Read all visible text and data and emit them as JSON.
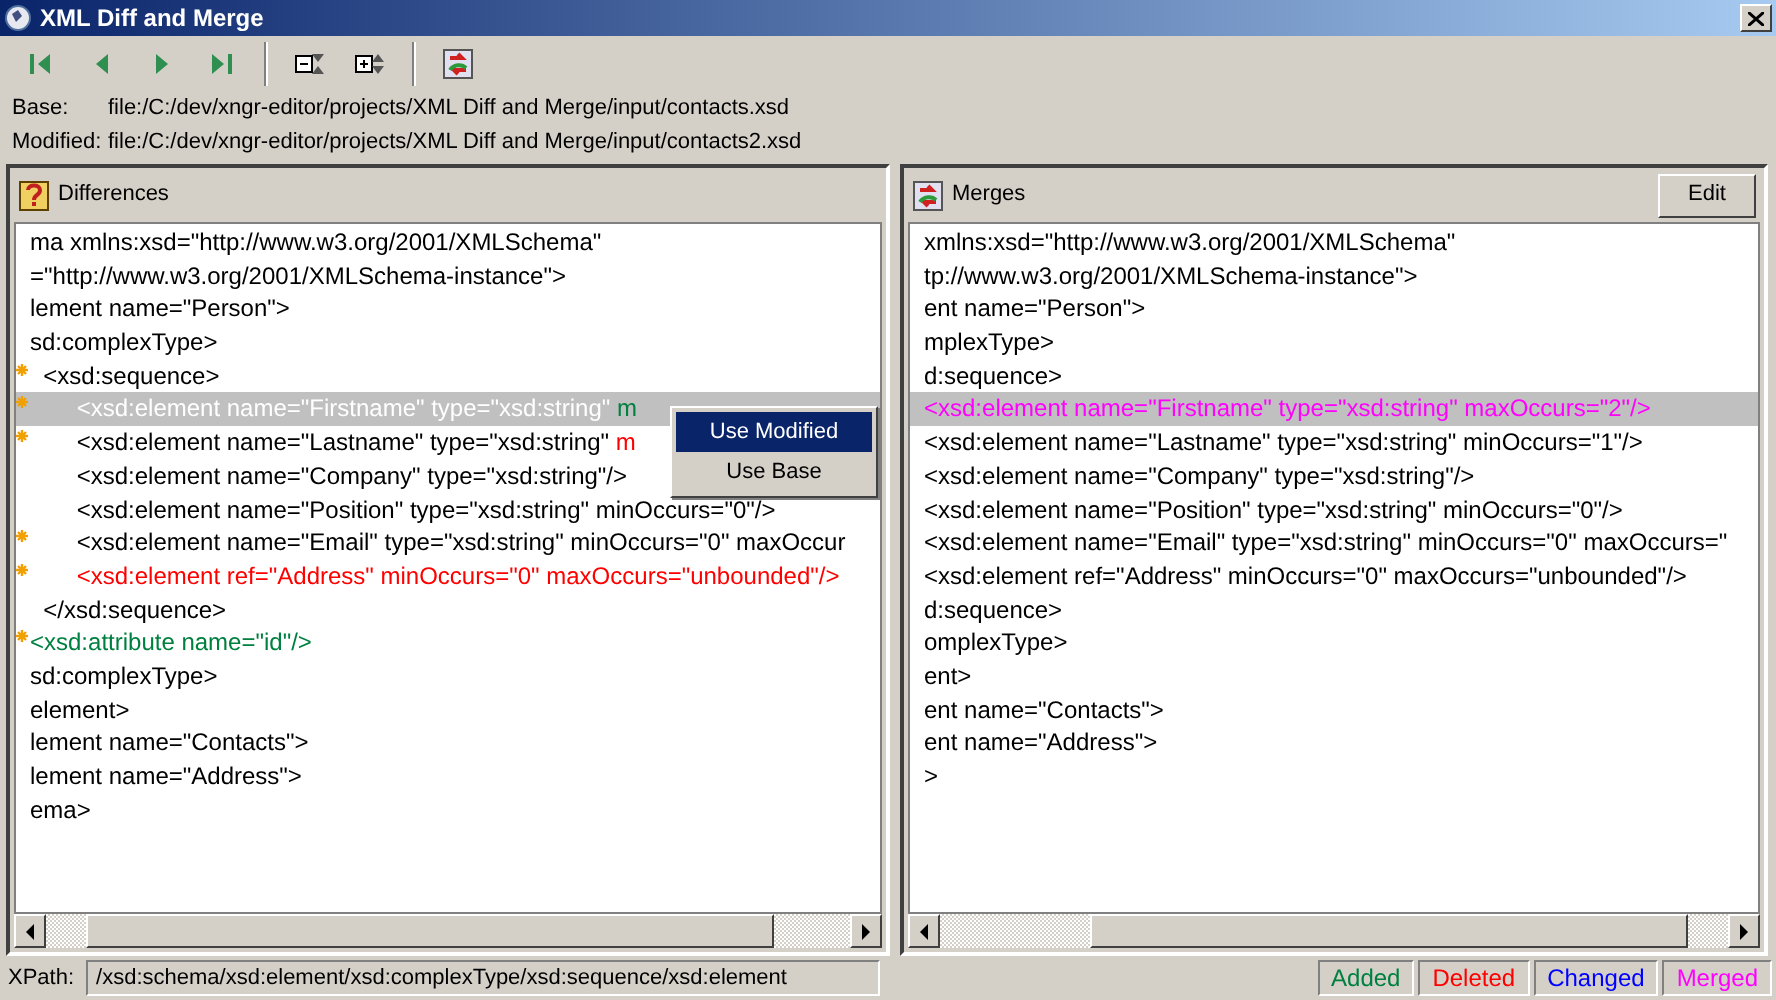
{
  "window": {
    "title": "XML Diff and Merge"
  },
  "toolbar": [
    {
      "kind": "first"
    },
    {
      "kind": "prev"
    },
    {
      "kind": "next"
    },
    {
      "kind": "last"
    },
    {
      "kind": "sep"
    },
    {
      "kind": "collapse"
    },
    {
      "kind": "expand"
    },
    {
      "kind": "sep"
    },
    {
      "kind": "merge"
    }
  ],
  "files": [
    {
      "label": "Base:",
      "path": "file:/C:/dev/xngr-editor/projects/XML Diff and Merge/input/contacts.xsd"
    },
    {
      "label": "Modified:",
      "path": "file:/C:/dev/xngr-editor/projects/XML Diff and Merge/input/contacts2.xsd"
    }
  ],
  "differences": {
    "title": "Differences",
    "lines": [
      {
        "changed": false,
        "selected": false,
        "segments": [
          {
            "kind": "normal",
            "text": "ma xmlns:xsd=\"http://www.w3.org/2001/XMLSchema\""
          }
        ]
      },
      {
        "changed": false,
        "selected": false,
        "segments": [
          {
            "kind": "normal",
            "text": "=\"http://www.w3.org/2001/XMLSchema-instance\">"
          }
        ]
      },
      {
        "changed": false,
        "selected": false,
        "segments": [
          {
            "kind": "normal",
            "text": "lement name=\"Person\">"
          }
        ]
      },
      {
        "changed": false,
        "selected": false,
        "segments": [
          {
            "kind": "normal",
            "text": "sd:complexType>"
          }
        ]
      },
      {
        "changed": true,
        "selected": false,
        "segments": [
          {
            "kind": "normal",
            "text": "  <xsd:sequence>"
          }
        ]
      },
      {
        "changed": true,
        "selected": true,
        "segments": [
          {
            "kind": "normal",
            "text": "       <xsd:element name=\"Firstname\" type=\"xsd:string\" "
          },
          {
            "kind": "added",
            "text": "m"
          }
        ]
      },
      {
        "changed": true,
        "selected": false,
        "segments": [
          {
            "kind": "normal",
            "text": "       <xsd:element name=\"Lastname\" type=\"xsd:string\" "
          },
          {
            "kind": "deleted",
            "text": "m"
          }
        ]
      },
      {
        "changed": false,
        "selected": false,
        "segments": [
          {
            "kind": "normal",
            "text": "       <xsd:element name=\"Company\" type=\"xsd:string\"/>"
          }
        ]
      },
      {
        "changed": false,
        "selected": false,
        "segments": [
          {
            "kind": "normal",
            "text": "       <xsd:element name=\"Position\" type=\"xsd:string\" minOccurs=\"0\"/>"
          }
        ]
      },
      {
        "changed": true,
        "selected": false,
        "segments": [
          {
            "kind": "normal",
            "text": "       <xsd:element name=\"Email\" type=\"xsd:string\" minOccurs=\"0\" maxOccur"
          }
        ]
      },
      {
        "changed": true,
        "selected": false,
        "segments": [
          {
            "kind": "deleted",
            "text": "       <xsd:element ref=\"Address\" minOccurs=\"0\" maxOccurs=\"unbounded\"/>"
          }
        ]
      },
      {
        "changed": false,
        "selected": false,
        "segments": [
          {
            "kind": "normal",
            "text": "  </xsd:sequence>"
          }
        ]
      },
      {
        "changed": true,
        "selected": false,
        "segments": [
          {
            "kind": "added",
            "text": "<xsd:attribute name=\"id\"/>"
          }
        ]
      },
      {
        "changed": false,
        "selected": false,
        "segments": [
          {
            "kind": "normal",
            "text": "sd:complexType>"
          }
        ]
      },
      {
        "changed": false,
        "selected": false,
        "segments": [
          {
            "kind": "normal",
            "text": "element>"
          }
        ]
      },
      {
        "changed": false,
        "selected": false,
        "segments": [
          {
            "kind": "normal",
            "text": "lement name=\"Contacts\">"
          }
        ]
      },
      {
        "changed": false,
        "selected": false,
        "segments": [
          {
            "kind": "normal",
            "text": "lement name=\"Address\">"
          }
        ]
      },
      {
        "changed": false,
        "selected": false,
        "segments": [
          {
            "kind": "normal",
            "text": "ema>"
          }
        ]
      }
    ]
  },
  "context_menu": [
    {
      "label": "Use Modified",
      "selected": true
    },
    {
      "label": "Use Base",
      "selected": false
    }
  ],
  "merges": {
    "title": "Merges",
    "button": "Edit",
    "lines": [
      {
        "selected": false,
        "segments": [
          {
            "kind": "normal",
            "text": "xmlns:xsd=\"http://www.w3.org/2001/XMLSchema\""
          }
        ]
      },
      {
        "selected": false,
        "segments": [
          {
            "kind": "normal",
            "text": "tp://www.w3.org/2001/XMLSchema-instance\">"
          }
        ]
      },
      {
        "selected": false,
        "segments": [
          {
            "kind": "normal",
            "text": "ent name=\"Person\">"
          }
        ]
      },
      {
        "selected": false,
        "segments": [
          {
            "kind": "normal",
            "text": "mplexType>"
          }
        ]
      },
      {
        "selected": false,
        "segments": [
          {
            "kind": "normal",
            "text": "d:sequence>"
          }
        ]
      },
      {
        "selected": true,
        "segments": [
          {
            "kind": "merged",
            "text": "<xsd:element name=\"Firstname\" type=\"xsd:string\" maxOccurs=\"2\"/>"
          }
        ]
      },
      {
        "selected": false,
        "segments": [
          {
            "kind": "normal",
            "text": "<xsd:element name=\"Lastname\" type=\"xsd:string\" minOccurs=\"1\"/>"
          }
        ]
      },
      {
        "selected": false,
        "segments": [
          {
            "kind": "normal",
            "text": "<xsd:element name=\"Company\" type=\"xsd:string\"/>"
          }
        ]
      },
      {
        "selected": false,
        "segments": [
          {
            "kind": "normal",
            "text": "<xsd:element name=\"Position\" type=\"xsd:string\" minOccurs=\"0\"/>"
          }
        ]
      },
      {
        "selected": false,
        "segments": [
          {
            "kind": "normal",
            "text": "<xsd:element name=\"Email\" type=\"xsd:string\" minOccurs=\"0\" maxOccurs=\""
          }
        ]
      },
      {
        "selected": false,
        "segments": [
          {
            "kind": "normal",
            "text": "<xsd:element ref=\"Address\" minOccurs=\"0\" maxOccurs=\"unbounded\"/>"
          }
        ]
      },
      {
        "selected": false,
        "segments": [
          {
            "kind": "normal",
            "text": "d:sequence>"
          }
        ]
      },
      {
        "selected": false,
        "segments": [
          {
            "kind": "normal",
            "text": "omplexType>"
          }
        ]
      },
      {
        "selected": false,
        "segments": [
          {
            "kind": "normal",
            "text": "ent>"
          }
        ]
      },
      {
        "selected": false,
        "segments": [
          {
            "kind": "normal",
            "text": "ent name=\"Contacts\">"
          }
        ]
      },
      {
        "selected": false,
        "segments": [
          {
            "kind": "normal",
            "text": "ent name=\"Address\">"
          }
        ]
      },
      {
        "selected": false,
        "segments": [
          {
            "kind": "normal",
            "text": ">"
          }
        ]
      }
    ]
  },
  "status_bar": {
    "label": "XPath:",
    "xpath": "/xsd:schema/xsd:element/xsd:complexType/xsd:sequence/xsd:element",
    "legend": [
      {
        "label": "Added",
        "color": "#008040"
      },
      {
        "label": "Deleted",
        "color": "#ff0000"
      },
      {
        "label": "Changed",
        "color": "#0000ff"
      },
      {
        "label": "Merged",
        "color": "#ff00ff"
      }
    ]
  }
}
